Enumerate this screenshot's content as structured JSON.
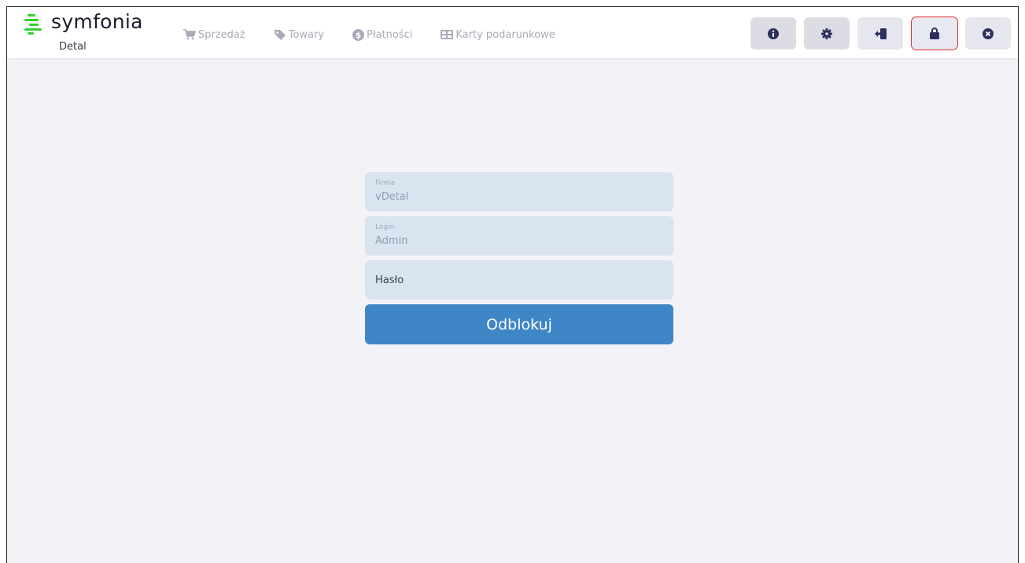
{
  "app": {
    "logo_text": "symfonia",
    "subtitle": "Detal",
    "brand_color": "#2fd12f"
  },
  "nav": {
    "items": [
      {
        "label": "Sprzedaż",
        "icon": "cart-icon"
      },
      {
        "label": "Towary",
        "icon": "tag-icon"
      },
      {
        "label": "Płatności",
        "icon": "dollar-circle-icon"
      },
      {
        "label": "Karty podarunkowe",
        "icon": "gift-card-icon"
      }
    ]
  },
  "toolbar": {
    "buttons": [
      {
        "name": "info",
        "icon": "info-icon"
      },
      {
        "name": "settings",
        "icon": "gear-icon"
      },
      {
        "name": "logout",
        "icon": "logout-icon"
      },
      {
        "name": "lock",
        "icon": "lock-icon",
        "highlighted": true
      },
      {
        "name": "close",
        "icon": "close-icon"
      }
    ]
  },
  "form": {
    "company_label": "Firma",
    "company_value": "vDetal",
    "login_label": "Login",
    "login_value": "Admin",
    "password_placeholder": "Hasło",
    "unlock_label": "Odblokuj",
    "accent_color": "#3f86c6"
  }
}
